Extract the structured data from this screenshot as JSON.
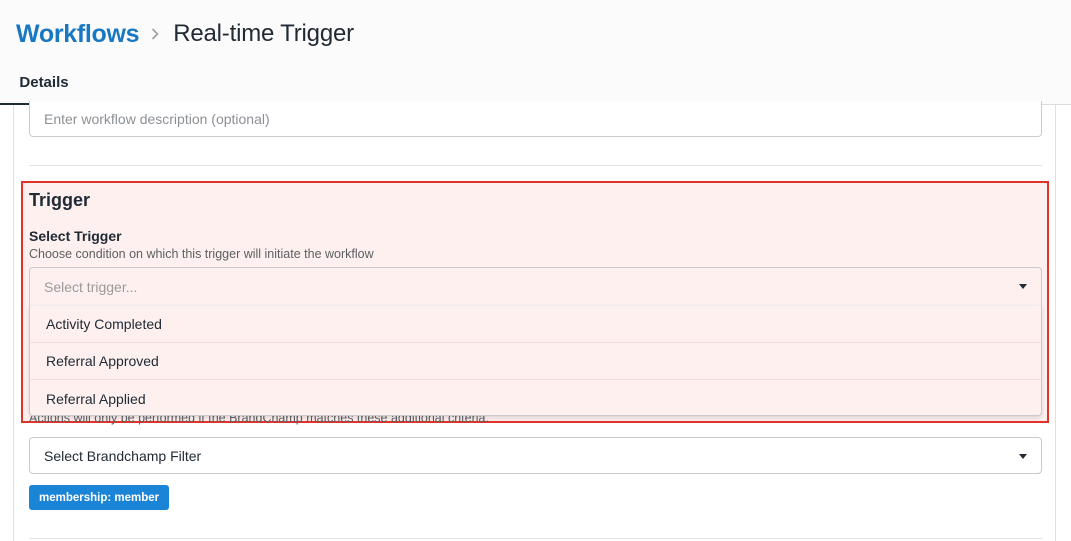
{
  "breadcrumb": {
    "parent": "Workflows",
    "current": "Real-time Trigger",
    "separator_icon": "chevron-right-icon"
  },
  "tabs": [
    {
      "label": "Details",
      "active": true
    }
  ],
  "description": {
    "placeholder": "Enter workflow description (optional)"
  },
  "trigger": {
    "title": "Trigger",
    "select_label": "Select Trigger",
    "help": "Choose condition on which this trigger will initiate the workflow",
    "placeholder": "Select trigger...",
    "options": [
      "Activity Completed",
      "Referral Approved",
      "Referral Applied"
    ]
  },
  "filter": {
    "hint": "Actions will only be performed if the BrandChamp matches these additional criteria.",
    "select_value": "Select Brandchamp Filter",
    "tag": "membership: member"
  },
  "colors": {
    "link": "#1a78c2",
    "highlight_border": "#e2332b",
    "highlight_bg": "#fdf0ef",
    "tag_bg": "#1a84d6"
  }
}
